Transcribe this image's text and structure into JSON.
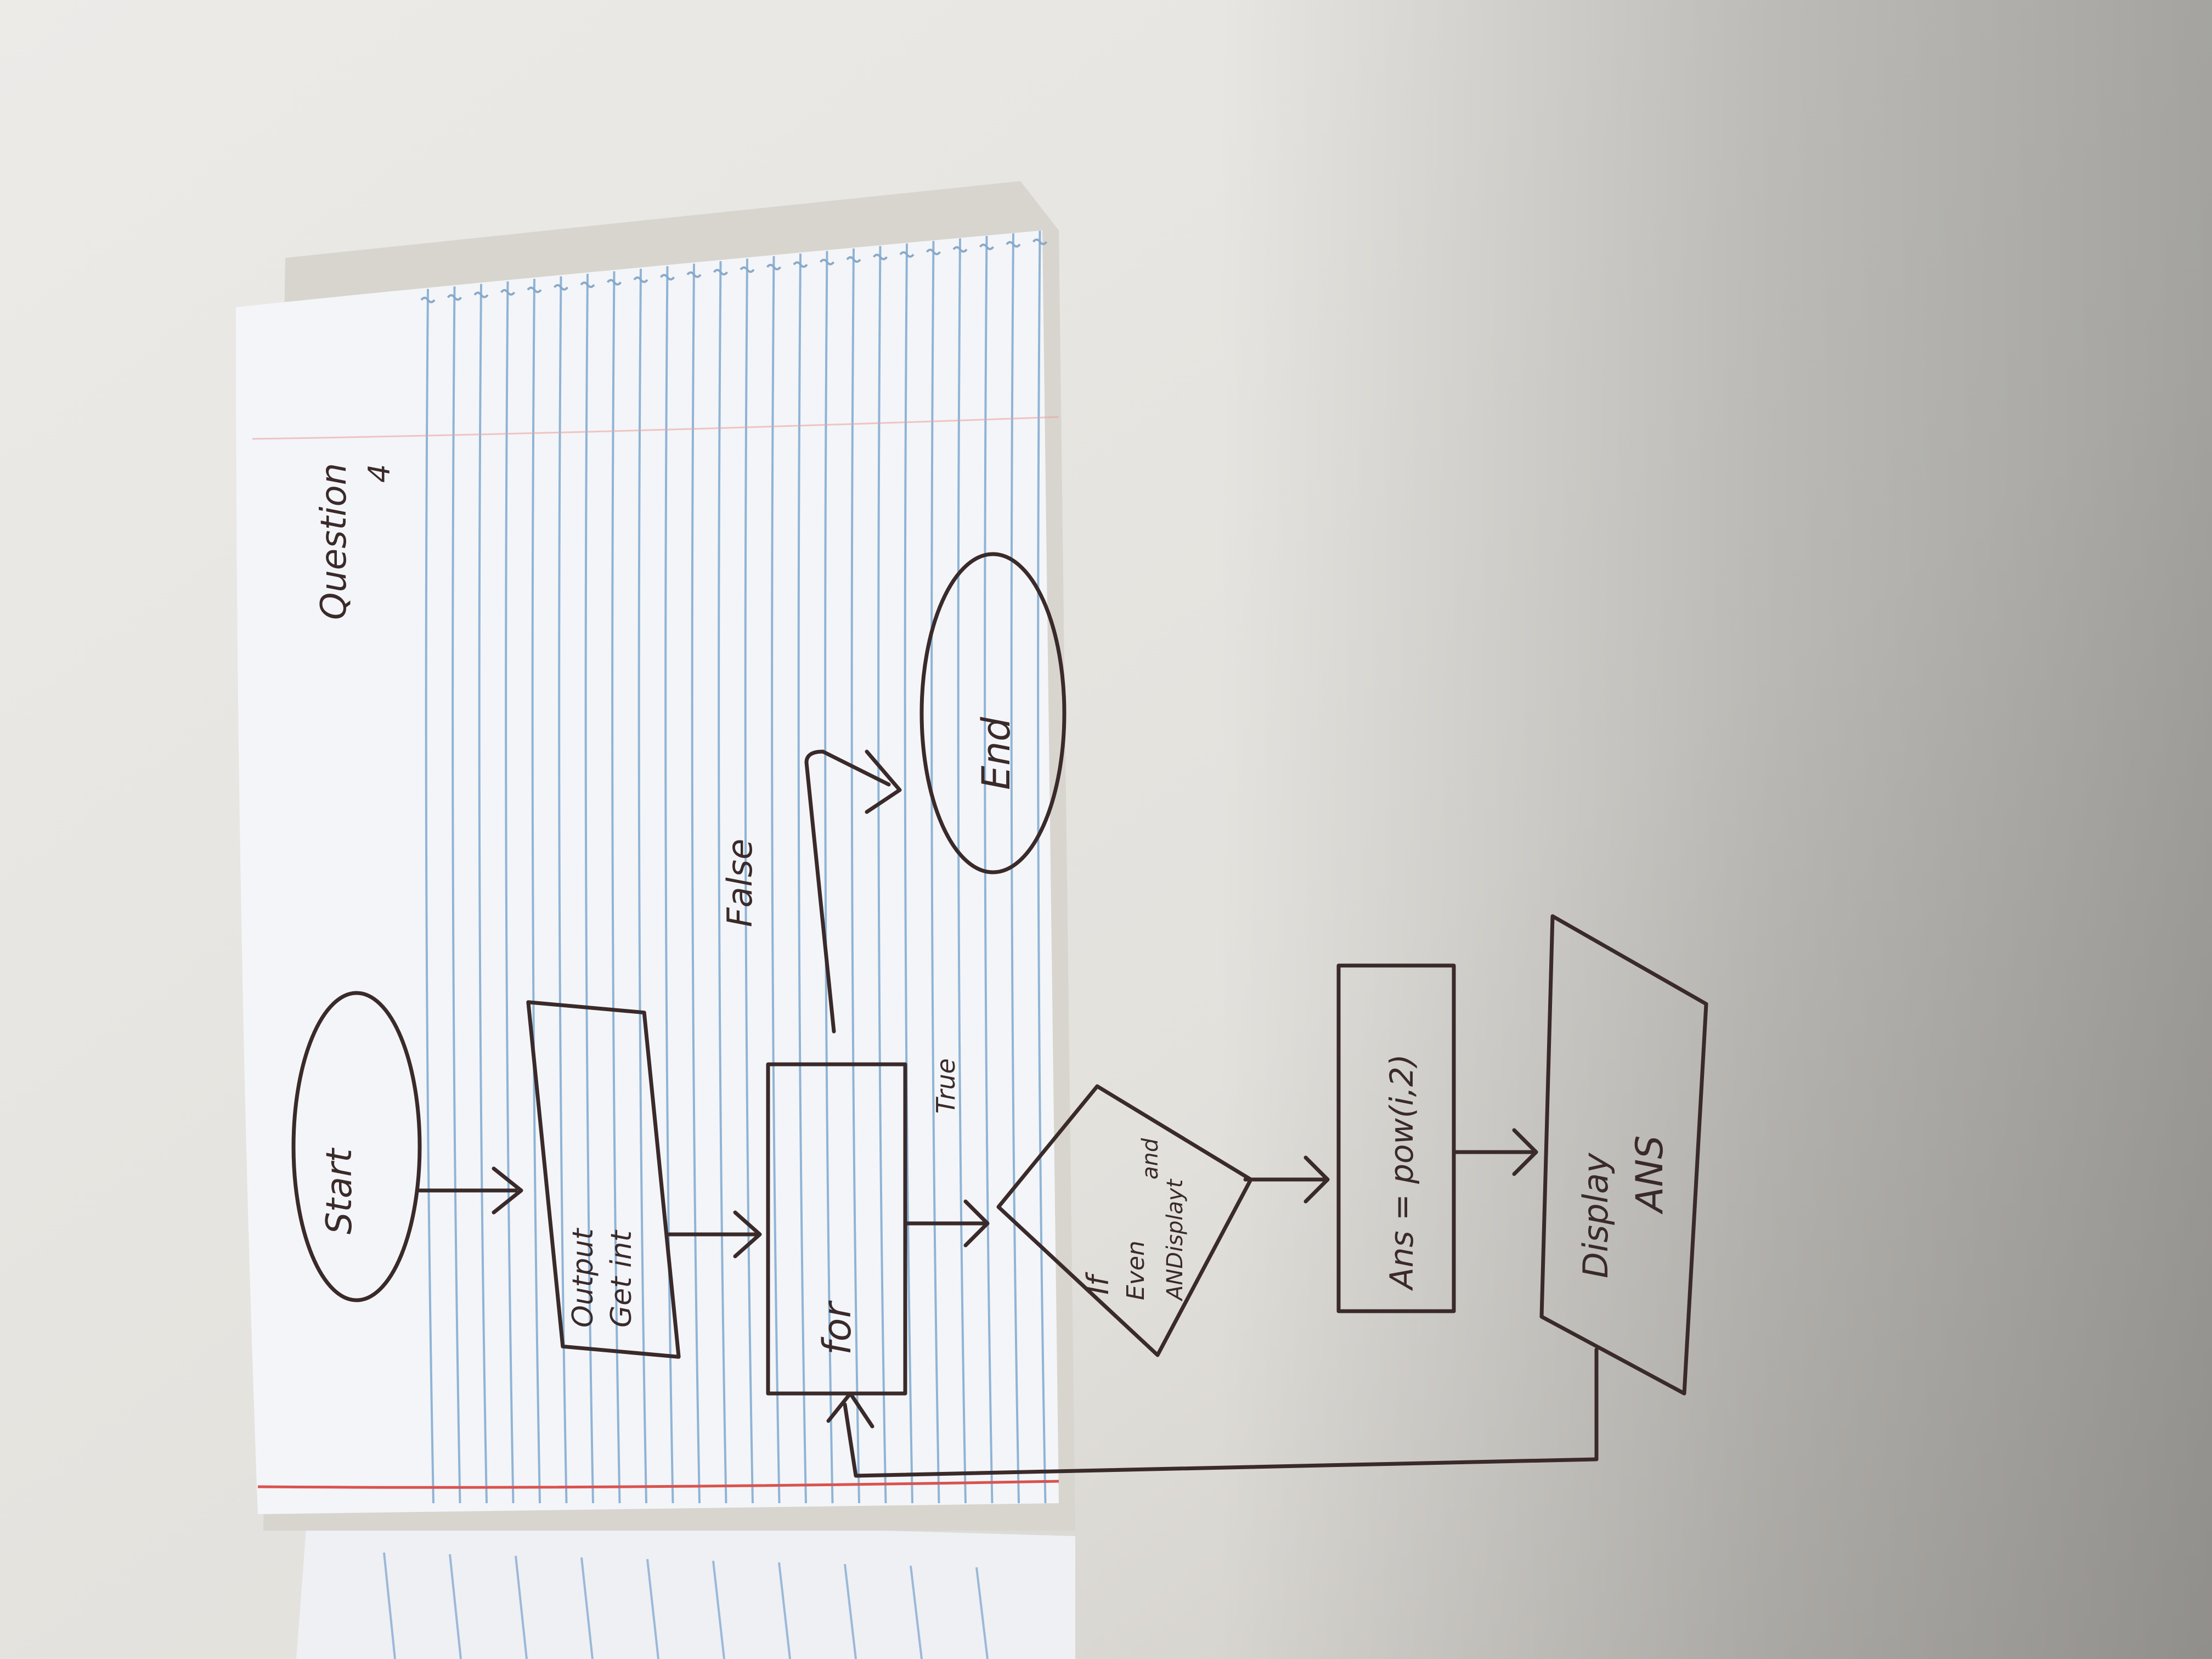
{
  "page_heading": {
    "line1": "Question",
    "line2": "4"
  },
  "flowchart": {
    "start": "Start",
    "input": {
      "line1": "Output",
      "line2": "Get int"
    },
    "loop": "for",
    "decision": {
      "line1": "If",
      "line2": "Even",
      "line3": "and",
      "line4": "ANDisplayt"
    },
    "process": "Ans = pow(i,2)",
    "display": {
      "line1": "Display",
      "line2": "ANS"
    },
    "false_label": "False",
    "true_label": "True",
    "end": "End"
  },
  "colors": {
    "ink": "#3a2a2a",
    "paper": "#f3f4f6",
    "rule_blue": "#8fb4d6",
    "margin_red": "#d9534f"
  }
}
